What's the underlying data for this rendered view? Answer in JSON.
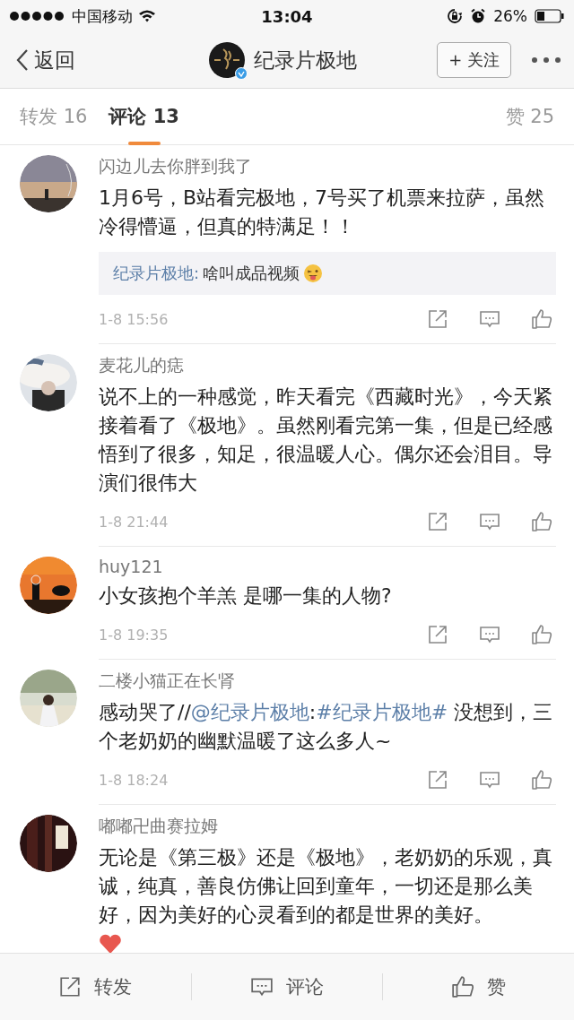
{
  "status_bar": {
    "carrier": "中国移动",
    "time": "13:04",
    "battery": "26%"
  },
  "nav": {
    "back": "返回",
    "title": "纪录片极地",
    "verified": true,
    "follow": "+ 关注"
  },
  "tabs": [
    {
      "label": "转发 16",
      "selected": false
    },
    {
      "label": "评论 13",
      "selected": true
    },
    {
      "label": "赞 25",
      "selected": false
    }
  ],
  "comments": [
    {
      "kind": "reply",
      "name": "闪边儿去你胖到我了",
      "text": [
        {
          "kind": "plain",
          "text": "1月6号，B站看完极地，7号买了机票来拉萨，虽然冷得懵逼，但真的特满足！！"
        }
      ],
      "reply": {
        "author": "纪录片极地:",
        "text": "啥叫成品视频"
      },
      "time": "1-8 15:56"
    },
    {
      "kind": "text",
      "name": "麦花儿的痣",
      "text": [
        {
          "kind": "plain",
          "text": "说不上的一种感觉，昨天看完《西藏时光》，今天紧接着看了《极地》。虽然刚看完第一集，但是已经感悟到了很多，知足，很温暖人心。偶尔还会泪目。导演们很伟大"
        }
      ],
      "time": "1-8 21:44"
    },
    {
      "kind": "text",
      "name": "huy121",
      "text": [
        {
          "kind": "plain",
          "text": "小女孩抱个羊羔 是哪一集的人物?"
        }
      ],
      "time": "1-8 19:35"
    },
    {
      "kind": "text",
      "name": "二楼小猫正在长肾",
      "text": [
        {
          "kind": "plain",
          "text": "感动哭了//"
        },
        {
          "kind": "link",
          "text": "@纪录片极地"
        },
        {
          "kind": "plain",
          "text": ":"
        },
        {
          "kind": "link",
          "text": "#纪录片极地#"
        },
        {
          "kind": "plain",
          "text": " 没想到，三个老奶奶的幽默温暖了这么多人~"
        }
      ],
      "time": "1-8 18:24"
    },
    {
      "kind": "heart",
      "name": "嘟嘟卍曲赛拉姆",
      "text": [
        {
          "kind": "plain",
          "text": "无论是《第三极》还是《极地》，老奶奶的乐观，真诚，纯真，善良仿佛让回到童年，一切还是那么美好，因为美好的心灵看到的都是世界的美好。"
        }
      ]
    }
  ],
  "toolbar": [
    {
      "kind": "share",
      "label": "转发"
    },
    {
      "kind": "comment",
      "label": "评论"
    },
    {
      "kind": "like",
      "label": "赞"
    }
  ]
}
